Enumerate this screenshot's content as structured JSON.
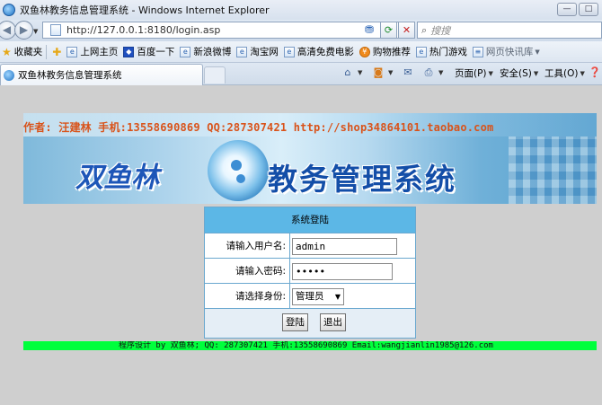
{
  "window": {
    "title": "双鱼林教务信息管理系统 - Windows Internet Explorer",
    "min_label": "—",
    "max_label": "□"
  },
  "address_bar": {
    "url": "http://127.0.0.1:8180/login.asp",
    "search_placeholder": "搜搜"
  },
  "favorites_bar": {
    "label": "收藏夹",
    "items": [
      {
        "label": "上网主页",
        "icon": "ie-page-icon"
      },
      {
        "label": "百度一下",
        "icon": "baidu-paw-icon"
      },
      {
        "label": "新浪微博",
        "icon": "ie-page-icon"
      },
      {
        "label": "淘宝网",
        "icon": "ie-page-icon"
      },
      {
        "label": "高清免费电影",
        "icon": "ie-page-icon"
      },
      {
        "label": "购物推荐",
        "icon": "shopping-icon"
      },
      {
        "label": "热门游戏",
        "icon": "ie-page-icon"
      },
      {
        "label": "网页快讯库",
        "icon": "web-slice-icon"
      }
    ]
  },
  "tab": {
    "title": "双鱼林教务信息管理系统"
  },
  "command_bar": {
    "page": "页面(P)",
    "safety": "安全(S)",
    "tools": "工具(O)"
  },
  "banner": {
    "author_line": "作者: 汪建林   手机:13558690869  QQ:287307421  http://shop34864101.taobao.com",
    "name": "双鱼林",
    "system": "教务管理系统"
  },
  "login": {
    "header": "系统登陆",
    "username_label": "请输入用户名:",
    "username_value": "admin",
    "password_label": "请输入密码:",
    "password_value": "12345",
    "role_label": "请选择身份:",
    "role_value": "管理员",
    "login_button": "登陆",
    "logout_button": "退出"
  },
  "footer": {
    "text": "程序设计 by 双鱼林; QQ: 287307421 手机:13558690869 Email:wangjianlin1985@126.com"
  },
  "colors": {
    "login_header": "#5cb7e6",
    "footer_bar": "#00ff3c",
    "page_background": "#cfcfcf",
    "author_text": "#d9531a",
    "banner_title": "#134ea8"
  }
}
